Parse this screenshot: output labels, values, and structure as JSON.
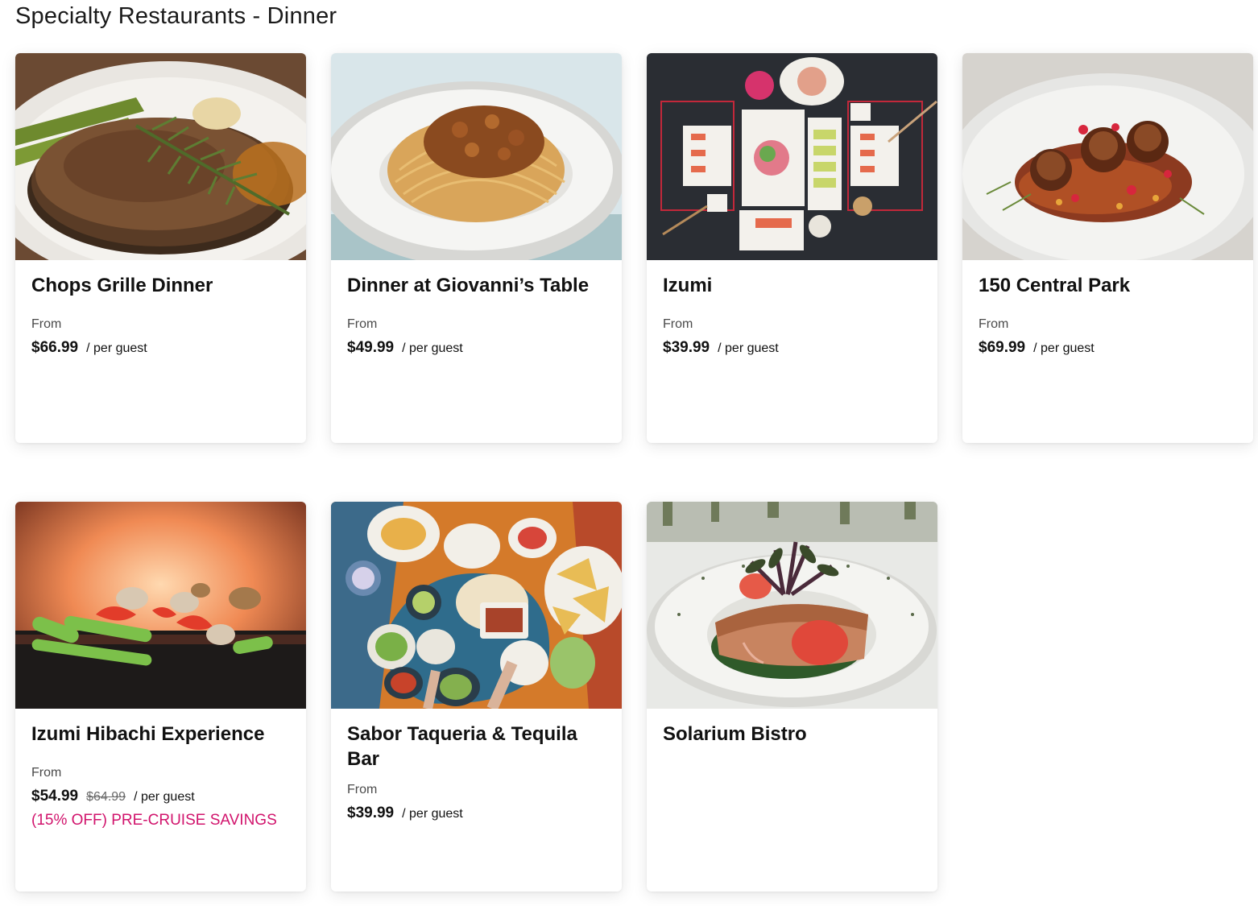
{
  "page": {
    "title": "Specialty Restaurants - Dinner"
  },
  "cards": [
    {
      "title": "Chops Grille Dinner",
      "from_label": "From",
      "price": "$66.99",
      "per_guest": "/ per guest",
      "image": "steak-with-rosemary"
    },
    {
      "title": "Dinner at Giovanni’s Table",
      "from_label": "From",
      "price": "$49.99",
      "per_guest": "/ per guest",
      "image": "spaghetti-bolognese"
    },
    {
      "title": "Izumi",
      "from_label": "From",
      "price": "$39.99",
      "per_guest": "/ per guest",
      "image": "sushi-platters-overhead"
    },
    {
      "title": "150 Central Park",
      "from_label": "From",
      "price": "$69.99",
      "per_guest": "/ per guest",
      "image": "seared-scallops"
    },
    {
      "title": "Izumi Hibachi Experience",
      "from_label": "From",
      "price": "$54.99",
      "old_price": "$64.99",
      "per_guest": "/ per guest",
      "promo": "(15% OFF) PRE-CRUISE SAVINGS",
      "image": "hibachi-grill-flames"
    },
    {
      "title": "Sabor Taqueria & Tequila Bar",
      "from_label": "From",
      "price": "$39.99",
      "per_guest": "/ per guest",
      "image": "mexican-spread-overhead"
    },
    {
      "title": "Solarium Bistro",
      "image": "salmon-with-tomatoes"
    }
  ],
  "colors": {
    "promo": "#d1136c",
    "text": "#111111",
    "muted": "#4a4a4a"
  }
}
